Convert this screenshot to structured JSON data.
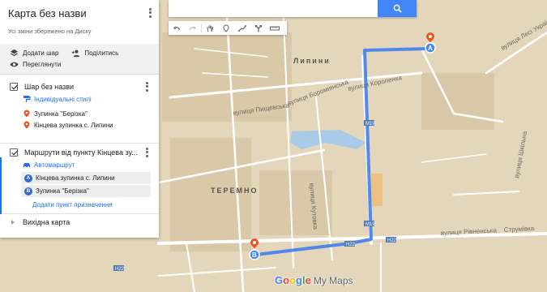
{
  "panel": {
    "map_title": "Карта без назви",
    "saved_status": "Усі зміни збережено на Диску",
    "actions": {
      "add_layer": "Додати шар",
      "share": "Поділитись",
      "preview": "Переглянути"
    },
    "layer1": {
      "title": "Шар без назви",
      "style_label": "Індивідуальні стилі",
      "places": [
        "Зупинка \"Берізка\"",
        "Кінцева зупинка с. Липини"
      ]
    },
    "layer2": {
      "title": "Маршрути від пункту Кінцева зу...",
      "mode_label": "Автомаршрут",
      "destinations": [
        {
          "letter": "A",
          "label": "Кінцева зупинка с. Липини"
        },
        {
          "letter": "B",
          "label": "Зупинка \"Берізка\""
        }
      ],
      "add_destination": "Додати пункт призначення"
    },
    "base_map": "Вихідна карта"
  },
  "search": {
    "placeholder": "",
    "value": ""
  },
  "map": {
    "labels": {
      "lypyny": "Липини",
      "teremno": "ТЕРЕМНО",
      "pyshchevska": "вулиця Пищевська",
      "boromlianska": "вулиця Бороміянська",
      "korolenka": "вулиця Короленка",
      "rivnenska": "вулиця Рівненська",
      "strumivka": "Струмівка",
      "lesi_ukrainky": "вулиця Лесі Українки",
      "shkilna": "вулиця Шкільна",
      "kutsaka": "вулиця Кутовка"
    },
    "road_shields": [
      "M19",
      "M19",
      "H22",
      "H22",
      "H22"
    ],
    "markers": [
      {
        "letter": "A"
      },
      {
        "letter": "B"
      }
    ],
    "colors": {
      "route": "#3f7ff0",
      "marker": "#e8541c",
      "pin": "#4285f4"
    }
  },
  "brand": {
    "google": "Google",
    "product": "My Maps"
  }
}
